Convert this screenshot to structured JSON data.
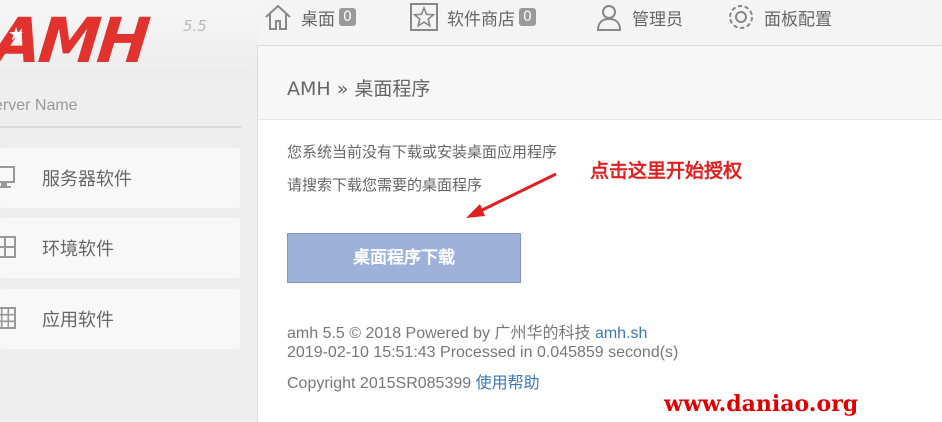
{
  "logo": {
    "text": "AMH",
    "version": "5.5"
  },
  "sidebar": {
    "server_name": "erver Name",
    "items": [
      {
        "label": "服务器软件",
        "icon": "monitor-icon"
      },
      {
        "label": "环境软件",
        "icon": "grid-4-icon"
      },
      {
        "label": "应用软件",
        "icon": "grid-9-icon"
      }
    ]
  },
  "topnav": {
    "items": [
      {
        "label": "桌面",
        "badge": "0",
        "icon": "home-icon"
      },
      {
        "label": "软件商店",
        "badge": "0",
        "icon": "star-icon"
      },
      {
        "label": "管理员",
        "icon": "user-icon"
      },
      {
        "label": "面板配置",
        "icon": "gear-icon"
      }
    ]
  },
  "breadcrumb": {
    "root": "AMH",
    "separator": "»",
    "current": "桌面程序"
  },
  "main": {
    "message_line1": "您系统当前没有下载或安装桌面应用程序",
    "message_line2": "请搜索下载您需要的桌面程序",
    "download_button": "桌面程序下载"
  },
  "footer": {
    "line1_prefix": "amh 5.5 © 2018 Powered by 广州华的科技",
    "line1_link": "amh.sh",
    "line2": "2019-02-10 15:51:43 Processed in 0.045859 second(s)",
    "line3_prefix": "Copyright 2015SR085399",
    "line3_link": "使用帮助"
  },
  "annotation": {
    "text": "点击这里开始授权"
  },
  "watermark": "www.daniao.org",
  "colors": {
    "logo_red": "#e2322e",
    "button_bg": "#9db1d9",
    "link": "#3b79b8",
    "annotation_red": "#e02020"
  }
}
